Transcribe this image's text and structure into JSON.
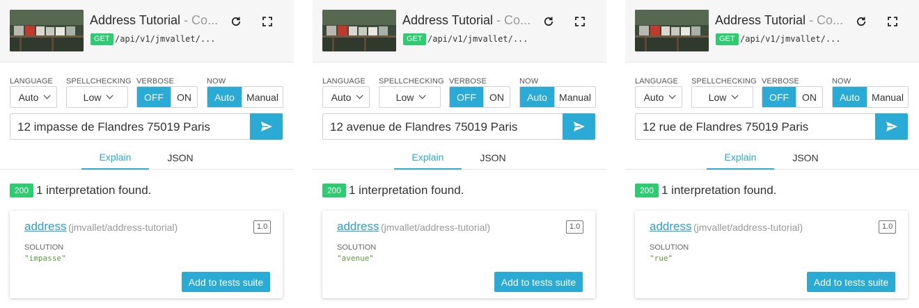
{
  "app": {
    "title": "Address Tutorial",
    "subtitle": " - Co...",
    "method": "GET",
    "endpoint": "/api/v1/jmvallet/...",
    "refresh_icon": "refresh-icon",
    "expand_icon": "fullscreen-icon"
  },
  "options": {
    "language": {
      "label": "LANGUAGE",
      "value": "Auto"
    },
    "spellchecking": {
      "label": "SPELLCHECKING",
      "value": "Low"
    },
    "verbose": {
      "label": "VERBOSE",
      "off": "OFF",
      "on": "ON",
      "selected": "OFF"
    },
    "now": {
      "label": "NOW",
      "auto": "Auto",
      "manual": "Manual",
      "selected": "Auto"
    }
  },
  "tabs": {
    "explain": "Explain",
    "json": "JSON",
    "active": "Explain"
  },
  "panels": [
    {
      "query": "12 impasse de Flandres 75019 Paris",
      "status_code": "200",
      "status_text": "1 interpretation found.",
      "intent": {
        "name": "address",
        "path": "(jmvallet/address-tutorial)",
        "version": "1.0"
      },
      "solution": {
        "label": "SOLUTION",
        "value": "\"impasse\""
      },
      "add_button": "Add to tests suite"
    },
    {
      "query": "12 avenue de Flandres 75019 Paris",
      "status_code": "200",
      "status_text": "1 interpretation found.",
      "intent": {
        "name": "address",
        "path": "(jmvallet/address-tutorial)",
        "version": "1.0"
      },
      "solution": {
        "label": "SOLUTION",
        "value": "\"avenue\""
      },
      "add_button": "Add to tests suite"
    },
    {
      "query": "12 rue de Flandres 75019 Paris",
      "status_code": "200",
      "status_text": "1 interpretation found.",
      "intent": {
        "name": "address",
        "path": "(jmvallet/address-tutorial)",
        "version": "1.0"
      },
      "solution": {
        "label": "SOLUTION",
        "value": "\"rue\""
      },
      "add_button": "Add to tests suite"
    }
  ],
  "colors": {
    "accent": "#29abd6",
    "success": "#2ecc71",
    "solution_text": "#5a9e3a",
    "header_bg": "#f6f6f6"
  }
}
